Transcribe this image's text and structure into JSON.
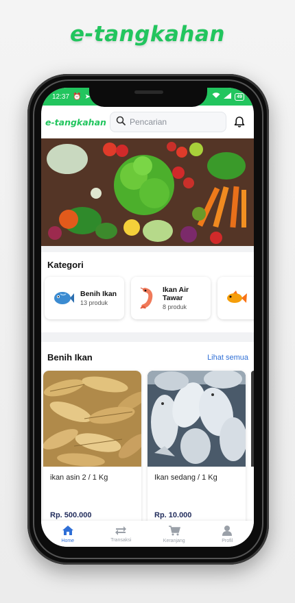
{
  "brand": {
    "title": "e-tangkahan"
  },
  "status_bar": {
    "time": "12:37",
    "battery": "49"
  },
  "header": {
    "logo": "e-tangkahan",
    "search_placeholder": "Pencarian"
  },
  "categories": {
    "title": "Kategori",
    "items": [
      {
        "name": "Benih Ikan",
        "count": "13 produk",
        "icon": "fish-blue-icon"
      },
      {
        "name": "Ikan Air Tawar",
        "count": "8 produk",
        "icon": "shrimp-icon"
      },
      {
        "name": "",
        "count": "",
        "icon": "goldfish-icon"
      }
    ]
  },
  "products": {
    "title": "Benih Ikan",
    "see_all": "Lihat semua",
    "items": [
      {
        "name": "ikan asin 2 / 1 Kg",
        "price": "Rp. 500.000"
      },
      {
        "name": "Ikan sedang / 1 Kg",
        "price": "Rp. 10.000"
      }
    ]
  },
  "bottom_nav": {
    "items": [
      {
        "label": "Home",
        "icon": "home-icon",
        "active": true
      },
      {
        "label": "Transaksi",
        "icon": "transfer-icon",
        "active": false
      },
      {
        "label": "Keranjang",
        "icon": "cart-icon",
        "active": false
      },
      {
        "label": "Profil",
        "icon": "user-icon",
        "active": false
      }
    ]
  },
  "colors": {
    "brand": "#22c55e",
    "accent": "#2f6fd6",
    "price": "#1f2a5a"
  }
}
